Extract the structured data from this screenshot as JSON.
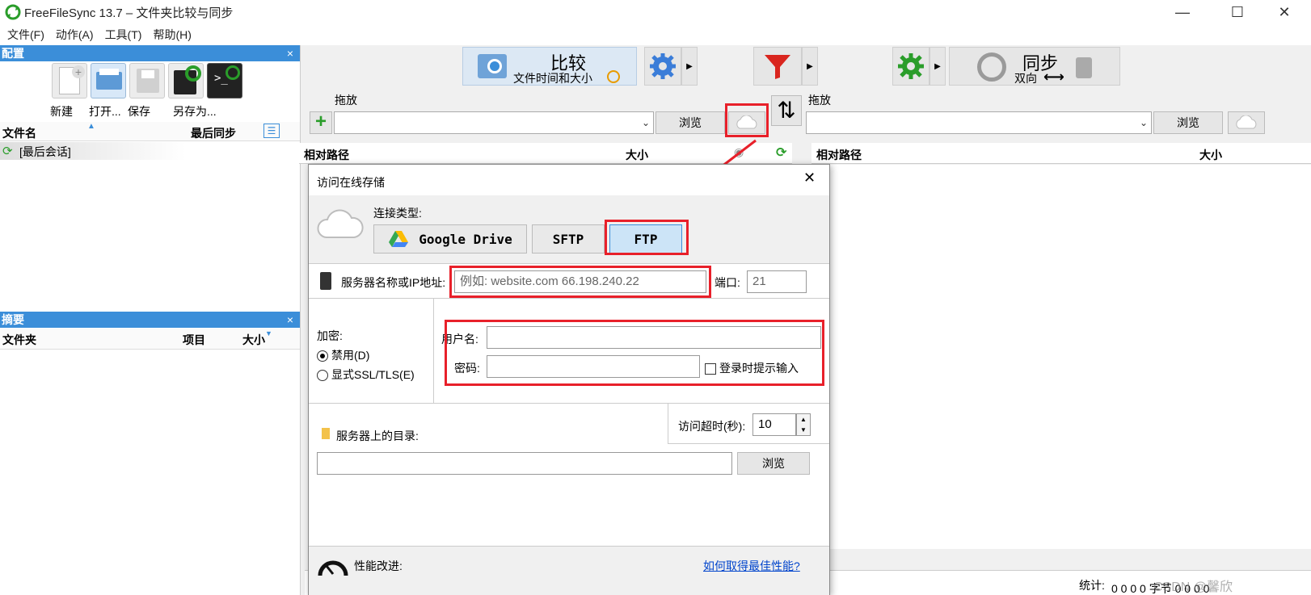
{
  "window": {
    "title": "FreeFileSync 13.7 – 文件夹比较与同步",
    "minimize": "—",
    "maximize": "☐",
    "close": "✕"
  },
  "menu": [
    "文件(F)",
    "动作(A)",
    "工具(T)",
    "帮助(H)"
  ],
  "config_panel": {
    "title": "配置",
    "close": "×",
    "tools": [
      {
        "label": "新建",
        "icon": "new-file-icon"
      },
      {
        "label": "打开...",
        "icon": "open-icon"
      },
      {
        "label": "保存",
        "icon": "save-icon"
      },
      {
        "label": "另存为...",
        "icon": "save-as-icon"
      }
    ],
    "columns": {
      "name": "文件名",
      "last_sync": "最后同步"
    },
    "items": [
      "[最后会话]"
    ]
  },
  "summary_panel": {
    "title": "摘要",
    "close": "×",
    "columns": {
      "folder": "文件夹",
      "items": "项目",
      "size": "大小"
    }
  },
  "toolbar": {
    "compare_title": "比较",
    "compare_sub": "文件时间和大小",
    "sync_title": "同步",
    "sync_sub": "双向"
  },
  "left_folder": {
    "drop_label": "拖放",
    "browse": "浏览"
  },
  "right_folder": {
    "drop_label": "拖放",
    "browse": "浏览"
  },
  "grid": {
    "left_rel_path": "相对路径",
    "left_size": "大小",
    "right_rel_path": "相对路径",
    "right_size": "大小"
  },
  "dialog": {
    "title": "访问在线存储",
    "close": "✕",
    "connection_type_label": "连接类型:",
    "types": [
      "Google Drive",
      "SFTP",
      "FTP"
    ],
    "selected_type": "FTP",
    "server_label": "服务器名称或IP地址:",
    "server_placeholder": "例如:    website.com    66.198.240.22",
    "port_label": "端口:",
    "port_value": "21",
    "encryption_label": "加密:",
    "encryption_options": [
      "禁用(D)",
      "显式SSL/TLS(E)"
    ],
    "username_label": "用户名:",
    "password_label": "密码:",
    "prompt_login": "登录时提示输入",
    "timeout_label": "访问超时(秒):",
    "timeout_value": "10",
    "server_dir_label": "服务器上的目录:",
    "browse": "浏览",
    "perf_label": "性能改进:",
    "perf_link": "如何取得最佳性能?"
  },
  "status": {
    "stats_label": "统计:",
    "counts": "0  0  0  0 字节  0  0  0  0",
    "watermark": "CSDN @馨欣"
  },
  "colors": {
    "accent": "#3b8ed9",
    "highlight": "#e8202a",
    "selected_btn": "#cce4f7"
  }
}
